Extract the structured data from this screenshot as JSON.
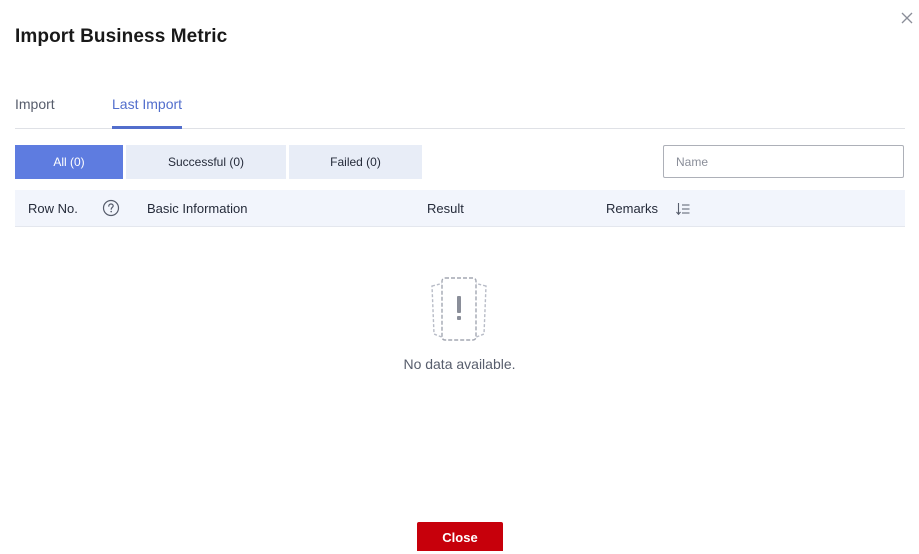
{
  "dialog": {
    "title": "Import Business Metric",
    "close_icon": "close-icon"
  },
  "tabs": [
    {
      "label": "Import",
      "active": false
    },
    {
      "label": "Last Import",
      "active": true
    }
  ],
  "filters": [
    {
      "label": "All (0)",
      "selected": true
    },
    {
      "label": "Successful (0)",
      "selected": false
    },
    {
      "label": "Failed (0)",
      "selected": false
    }
  ],
  "search": {
    "placeholder": "Name",
    "value": ""
  },
  "table": {
    "columns": [
      {
        "label": "Row No.",
        "icon": "help-icon"
      },
      {
        "label": "Basic Information"
      },
      {
        "label": "Result"
      },
      {
        "label": "Remarks",
        "icon": "sort-icon"
      }
    ],
    "rows": []
  },
  "empty_state": {
    "icon": "no-data-icon",
    "text": "No data available."
  },
  "footer": {
    "close_label": "Close"
  },
  "colors": {
    "accent": "#5e7ce0",
    "tab_active": "#526ecc",
    "close_button": "#c7000b",
    "header_bg": "#f2f5fc"
  }
}
